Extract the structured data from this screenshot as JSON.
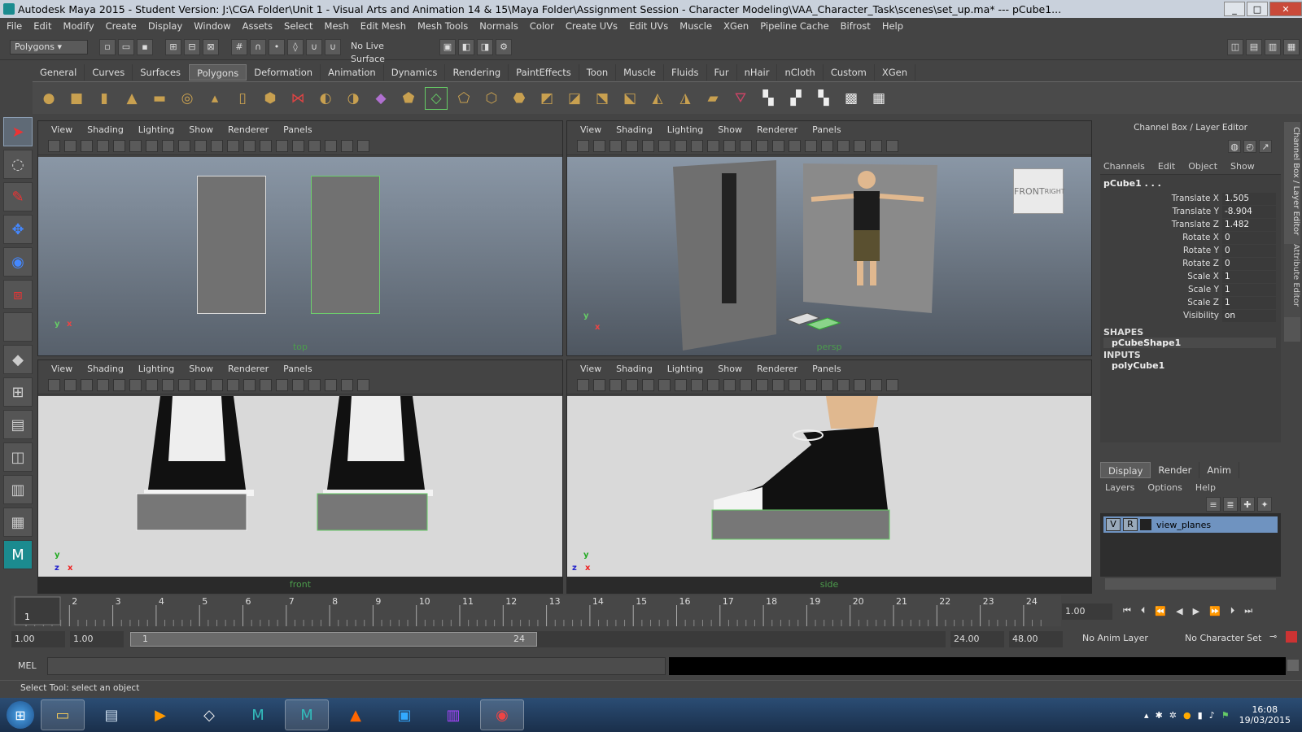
{
  "window": {
    "title": "Autodesk Maya 2015 - Student Version: J:\\CGA Folder\\Unit 1 - Visual Arts and Animation 14 & 15\\Maya Folder\\Assignment Session - Character Modeling\\VAA_Character_Task\\scenes\\set_up.ma*  ---  pCube1..."
  },
  "menubar": [
    "File",
    "Edit",
    "Modify",
    "Create",
    "Display",
    "Window",
    "Assets",
    "Select",
    "Mesh",
    "Edit Mesh",
    "Mesh Tools",
    "Normals",
    "Color",
    "Create UVs",
    "Edit UVs",
    "Muscle",
    "XGen",
    "Pipeline Cache",
    "Bifrost",
    "Help"
  ],
  "statusline": {
    "mode": "Polygons",
    "live_surface": "No Live Surface"
  },
  "shelf_tabs": [
    "General",
    "Curves",
    "Surfaces",
    "Polygons",
    "Deformation",
    "Animation",
    "Dynamics",
    "Rendering",
    "PaintEffects",
    "Toon",
    "Muscle",
    "Fluids",
    "Fur",
    "nHair",
    "nCloth",
    "Custom",
    "XGen"
  ],
  "viewport_menu": [
    "View",
    "Shading",
    "Lighting",
    "Show",
    "Renderer",
    "Panels"
  ],
  "viewports": {
    "top": {
      "camera": "top",
      "axis_y": "y",
      "axis_x": "x"
    },
    "persp": {
      "camera": "persp",
      "axis_y": "y",
      "axis_x": "x",
      "cube_front": "FRONT",
      "cube_right": "RIGHT"
    },
    "front": {
      "camera": "front",
      "axis_y": "y",
      "axis_z": "z",
      "axis_x": "x"
    },
    "side": {
      "camera": "side",
      "axis_y": "y",
      "axis_z": "z",
      "axis_x": "x"
    }
  },
  "channel_box": {
    "title": "Channel Box / Layer Editor",
    "menu": [
      "Channels",
      "Edit",
      "Object",
      "Show"
    ],
    "object": "pCube1 . . .",
    "attrs": [
      {
        "label": "Translate X",
        "value": "1.505"
      },
      {
        "label": "Translate Y",
        "value": "-8.904"
      },
      {
        "label": "Translate Z",
        "value": "1.482"
      },
      {
        "label": "Rotate X",
        "value": "0"
      },
      {
        "label": "Rotate Y",
        "value": "0"
      },
      {
        "label": "Rotate Z",
        "value": "0"
      },
      {
        "label": "Scale X",
        "value": "1"
      },
      {
        "label": "Scale Y",
        "value": "1"
      },
      {
        "label": "Scale Z",
        "value": "1"
      },
      {
        "label": "Visibility",
        "value": "on"
      }
    ],
    "shapes_header": "SHAPES",
    "shape": "pCubeShape1",
    "inputs_header": "INPUTS",
    "input": "polyCube1",
    "side_tab_1": "Channel Box / Layer Editor",
    "side_tab_2": "Attribute Editor"
  },
  "layer_editor": {
    "tabs": [
      "Display",
      "Render",
      "Anim"
    ],
    "menu": [
      "Layers",
      "Options",
      "Help"
    ],
    "layer": {
      "v": "V",
      "r": "R",
      "name": "view_planes"
    }
  },
  "timeline": {
    "ticks": [
      "1",
      "2",
      "3",
      "4",
      "5",
      "6",
      "7",
      "8",
      "9",
      "10",
      "11",
      "12",
      "13",
      "14",
      "15",
      "16",
      "17",
      "18",
      "19",
      "20",
      "21",
      "22",
      "23",
      "24"
    ],
    "current_frame": "1.00",
    "cursor": "1"
  },
  "range": {
    "start_time": "1.00",
    "start_range": "1.00",
    "slider_start": "1",
    "slider_end": "24",
    "end_range": "24.00",
    "end_time": "48.00",
    "anim_layer": "No Anim Layer",
    "char_set": "No Character Set"
  },
  "mel": {
    "label": "MEL"
  },
  "help_line": "Select Tool: select an object",
  "taskbar": {
    "time": "16:08",
    "date": "19/03/2015"
  }
}
